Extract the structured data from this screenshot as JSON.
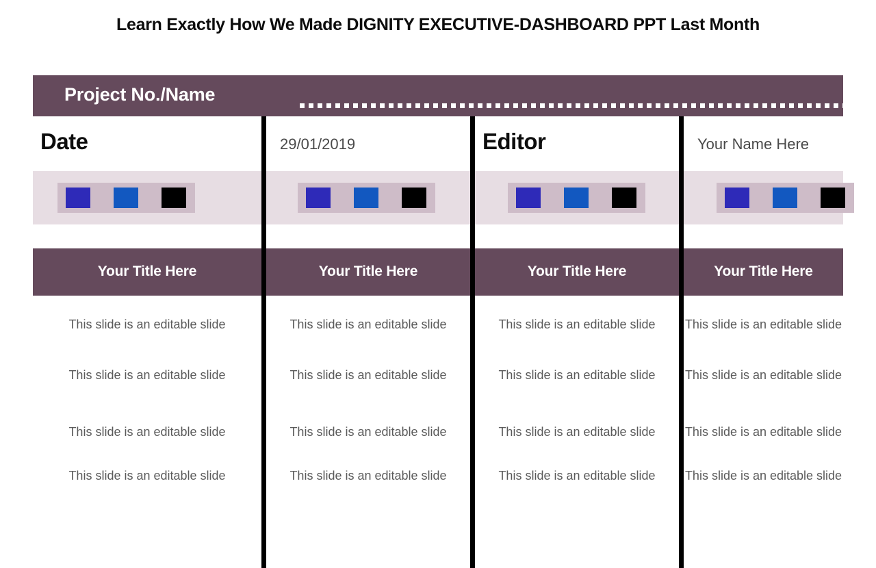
{
  "slide": {
    "title": "Learn Exactly How We Made DIGNITY EXECUTIVE-DASHBOARD PPT Last Month"
  },
  "theme": {
    "plum": "#654A5C",
    "band_light": "#E7DDE3",
    "band_dark": "#CEBCC8",
    "swatch_indigo": "#2E2AB8",
    "swatch_blue": "#1258C0",
    "swatch_black": "#000000",
    "divider": "#000000"
  },
  "project_header": {
    "label": "Project No./Name",
    "value_placeholder": ""
  },
  "meta": {
    "date_label": "Date",
    "date_value": "29/01/2019",
    "editor_label": "Editor",
    "editor_value": "Your Name Here"
  },
  "swatches": {
    "groups": [
      {
        "colors": [
          "#2E2AB8",
          "#1258C0",
          "#000000"
        ]
      },
      {
        "colors": [
          "#2E2AB8",
          "#1258C0",
          "#000000"
        ]
      },
      {
        "colors": [
          "#2E2AB8",
          "#1258C0",
          "#000000"
        ]
      },
      {
        "colors": [
          "#2E2AB8",
          "#1258C0",
          "#000000"
        ]
      }
    ]
  },
  "columns": [
    {
      "title": "Your Title Here"
    },
    {
      "title": "Your Title Here"
    },
    {
      "title": "Your Title Here"
    },
    {
      "title": "Your Title Here"
    }
  ],
  "body": {
    "rows": [
      [
        "This slide is an editable slide",
        "This slide is an editable slide",
        "This slide is an editable slide",
        "This slide is an editable slide"
      ],
      [
        "This slide is an editable slide",
        "This slide is an editable slide",
        "This slide is an editable slide",
        "This slide is an editable slide"
      ],
      [
        "This slide is an editable slide",
        "This slide is an editable slide",
        "This slide is an editable slide",
        "This slide is an editable slide"
      ],
      [
        "This slide is an editable slide",
        "This slide is an editable slide",
        "This slide is an editable slide",
        "This slide is an editable slide"
      ]
    ]
  }
}
